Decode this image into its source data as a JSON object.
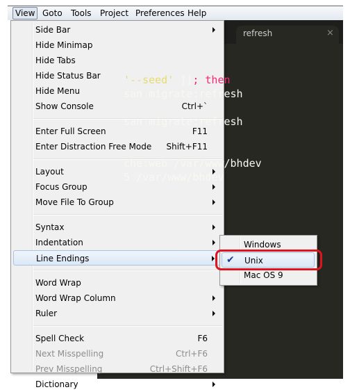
{
  "menubar": {
    "items": [
      "View",
      "Goto",
      "Tools",
      "Project",
      "Preferences",
      "Help"
    ],
    "active": "View"
  },
  "editor": {
    "tab_title": "refresh",
    "tab_close": "×",
    "lines": [
      {
        "parts": [
          {
            "t": "'--seed'",
            "c": "#e6db74"
          },
          {
            "t": " ]]",
            "c": "#f8f8f2"
          },
          {
            "t": "; then",
            "c": "#f92672"
          }
        ]
      },
      {
        "parts": [
          {
            "t": "san migrate:refresh",
            "c": "#f8f8f2"
          }
        ]
      },
      {
        "parts": [
          {
            "t": "san migrate:refresh",
            "c": "#f8f8f2"
          }
        ]
      },
      {
        "parts": [
          {
            "t": "che:web /var/www/bhdev",
            "c": "#f8f8f2"
          }
        ]
      },
      {
        "parts": [
          {
            "t": "5 /var/www/bhdev",
            "c": "#f8f8f2"
          }
        ]
      }
    ]
  },
  "view_menu": {
    "groups": [
      [
        {
          "label": "Side Bar",
          "submenu": true
        },
        {
          "label": "Hide Minimap"
        },
        {
          "label": "Hide Tabs"
        },
        {
          "label": "Hide Status Bar"
        },
        {
          "label": "Hide Menu"
        },
        {
          "label": "Show Console",
          "shortcut": "Ctrl+`"
        }
      ],
      [
        {
          "label": "Enter Full Screen",
          "shortcut": "F11"
        },
        {
          "label": "Enter Distraction Free Mode",
          "shortcut": "Shift+F11"
        }
      ],
      [
        {
          "label": "Layout",
          "submenu": true
        },
        {
          "label": "Focus Group",
          "submenu": true
        },
        {
          "label": "Move File To Group",
          "submenu": true
        }
      ],
      [
        {
          "label": "Syntax",
          "submenu": true
        },
        {
          "label": "Indentation",
          "submenu": true
        },
        {
          "label": "Line Endings",
          "submenu": true,
          "highlighted": true
        }
      ],
      [
        {
          "label": "Word Wrap"
        },
        {
          "label": "Word Wrap Column",
          "submenu": true
        },
        {
          "label": "Ruler",
          "submenu": true
        }
      ],
      [
        {
          "label": "Spell Check",
          "shortcut": "F6"
        },
        {
          "label": "Next Misspelling",
          "shortcut": "Ctrl+F6",
          "disabled": true
        },
        {
          "label": "Prev Misspelling",
          "shortcut": "Ctrl+Shift+F6",
          "disabled": true
        },
        {
          "label": "Dictionary",
          "submenu": true
        }
      ]
    ]
  },
  "line_endings_submenu": {
    "items": [
      {
        "label": "Windows"
      },
      {
        "label": "Unix",
        "checked": true,
        "highlighted": true
      },
      {
        "label": "Mac OS 9"
      }
    ]
  },
  "annotation_color": "#e0141e"
}
